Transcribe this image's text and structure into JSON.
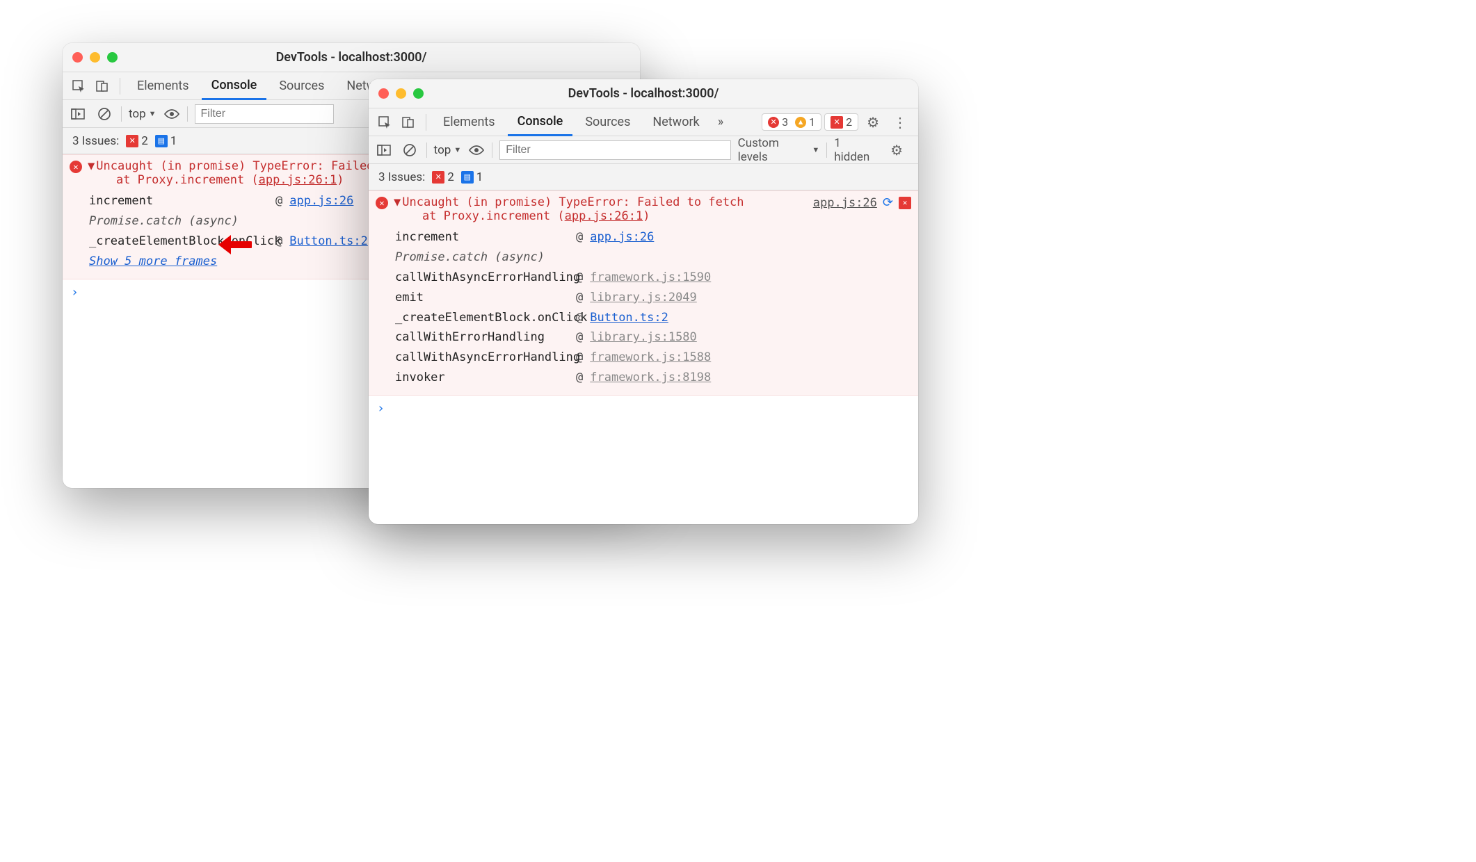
{
  "title": "DevTools - localhost:3000/",
  "tabs": {
    "elements": "Elements",
    "console": "Console",
    "sources": "Sources",
    "network": "Network"
  },
  "filter": {
    "top": "top",
    "placeholder": "Filter",
    "custom": "Custom levels",
    "hidden": "1 hidden"
  },
  "issues": {
    "label": "3 Issues:",
    "err": "2",
    "msg": "1"
  },
  "badges": {
    "err": "3",
    "warn": "1",
    "errsq": "2"
  },
  "errA": {
    "head1": "Uncaught (in promise) TypeError: Failed to f",
    "head2": "    at Proxy.increment (",
    "headLink": "app.js:26:1",
    "rows": [
      {
        "fn": "increment",
        "link": "app.js:26",
        "cls": ""
      },
      {
        "fn": "Promise.catch (async)",
        "italic": true
      },
      {
        "fn": "_createElementBlock.onClick",
        "link": "Button.ts:2",
        "cls": ""
      }
    ],
    "showMore": "Show 5 more frames"
  },
  "errB": {
    "head1": "Uncaught (in promise) TypeError: Failed to fetch",
    "head2": "    at Proxy.increment (",
    "headLink": "app.js:26:1",
    "corner": "app.js:26",
    "rows": [
      {
        "fn": "increment",
        "link": "app.js:26",
        "cls": ""
      },
      {
        "fn": "Promise.catch (async)",
        "italic": true
      },
      {
        "fn": "callWithAsyncErrorHandling",
        "link": "framework.js:1590",
        "cls": "grey"
      },
      {
        "fn": "emit",
        "link": "library.js:2049",
        "cls": "grey"
      },
      {
        "fn": "_createElementBlock.onClick",
        "link": "Button.ts:2",
        "cls": ""
      },
      {
        "fn": "callWithErrorHandling",
        "link": "library.js:1580",
        "cls": "grey"
      },
      {
        "fn": "callWithAsyncErrorHandling",
        "link": "framework.js:1588",
        "cls": "grey"
      },
      {
        "fn": "invoker",
        "link": "framework.js:8198",
        "cls": "grey"
      }
    ]
  }
}
